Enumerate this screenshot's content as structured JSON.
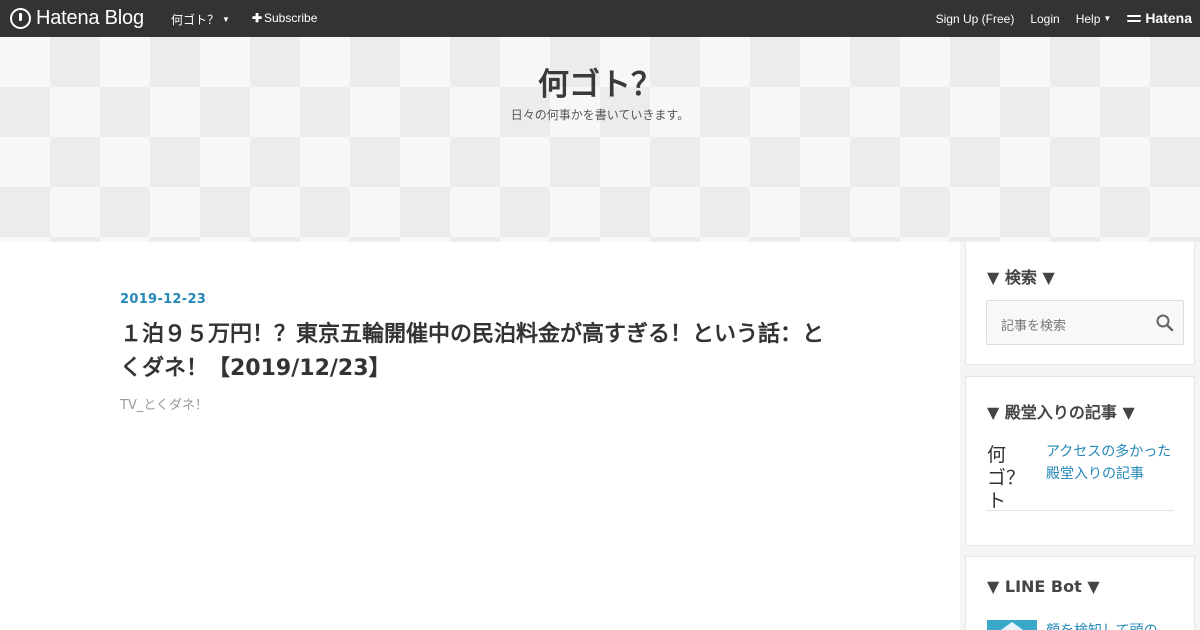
{
  "topbar": {
    "brand": "Hatena Blog",
    "blog_menu": "何ゴト？",
    "subscribe": "Subscribe",
    "signup": "Sign Up (Free)",
    "login": "Login",
    "help": "Help",
    "hatena": "Hatena"
  },
  "header": {
    "title": "何ゴト？",
    "description": "日々の何事かを書いていきます。"
  },
  "post": {
    "date": "2019-12-23",
    "title": "１泊９５万円！？東京五輪開催中の民泊料金が高すぎる！という話：とくダネ！【2019/12/23】",
    "category": "TV_とくダネ！"
  },
  "sidebar": {
    "search": {
      "title": "▼ 検索 ▼",
      "placeholder": "記事を検索"
    },
    "fame": {
      "title": "▼ 殿堂入りの記事 ▼",
      "thumb_text": "何ゴ？ト",
      "link": "アクセスの多かった殿堂入りの記事"
    },
    "line_bot": {
      "title": "▼ LINE Bot ▼",
      "link": "顔を検知して頭の"
    }
  }
}
